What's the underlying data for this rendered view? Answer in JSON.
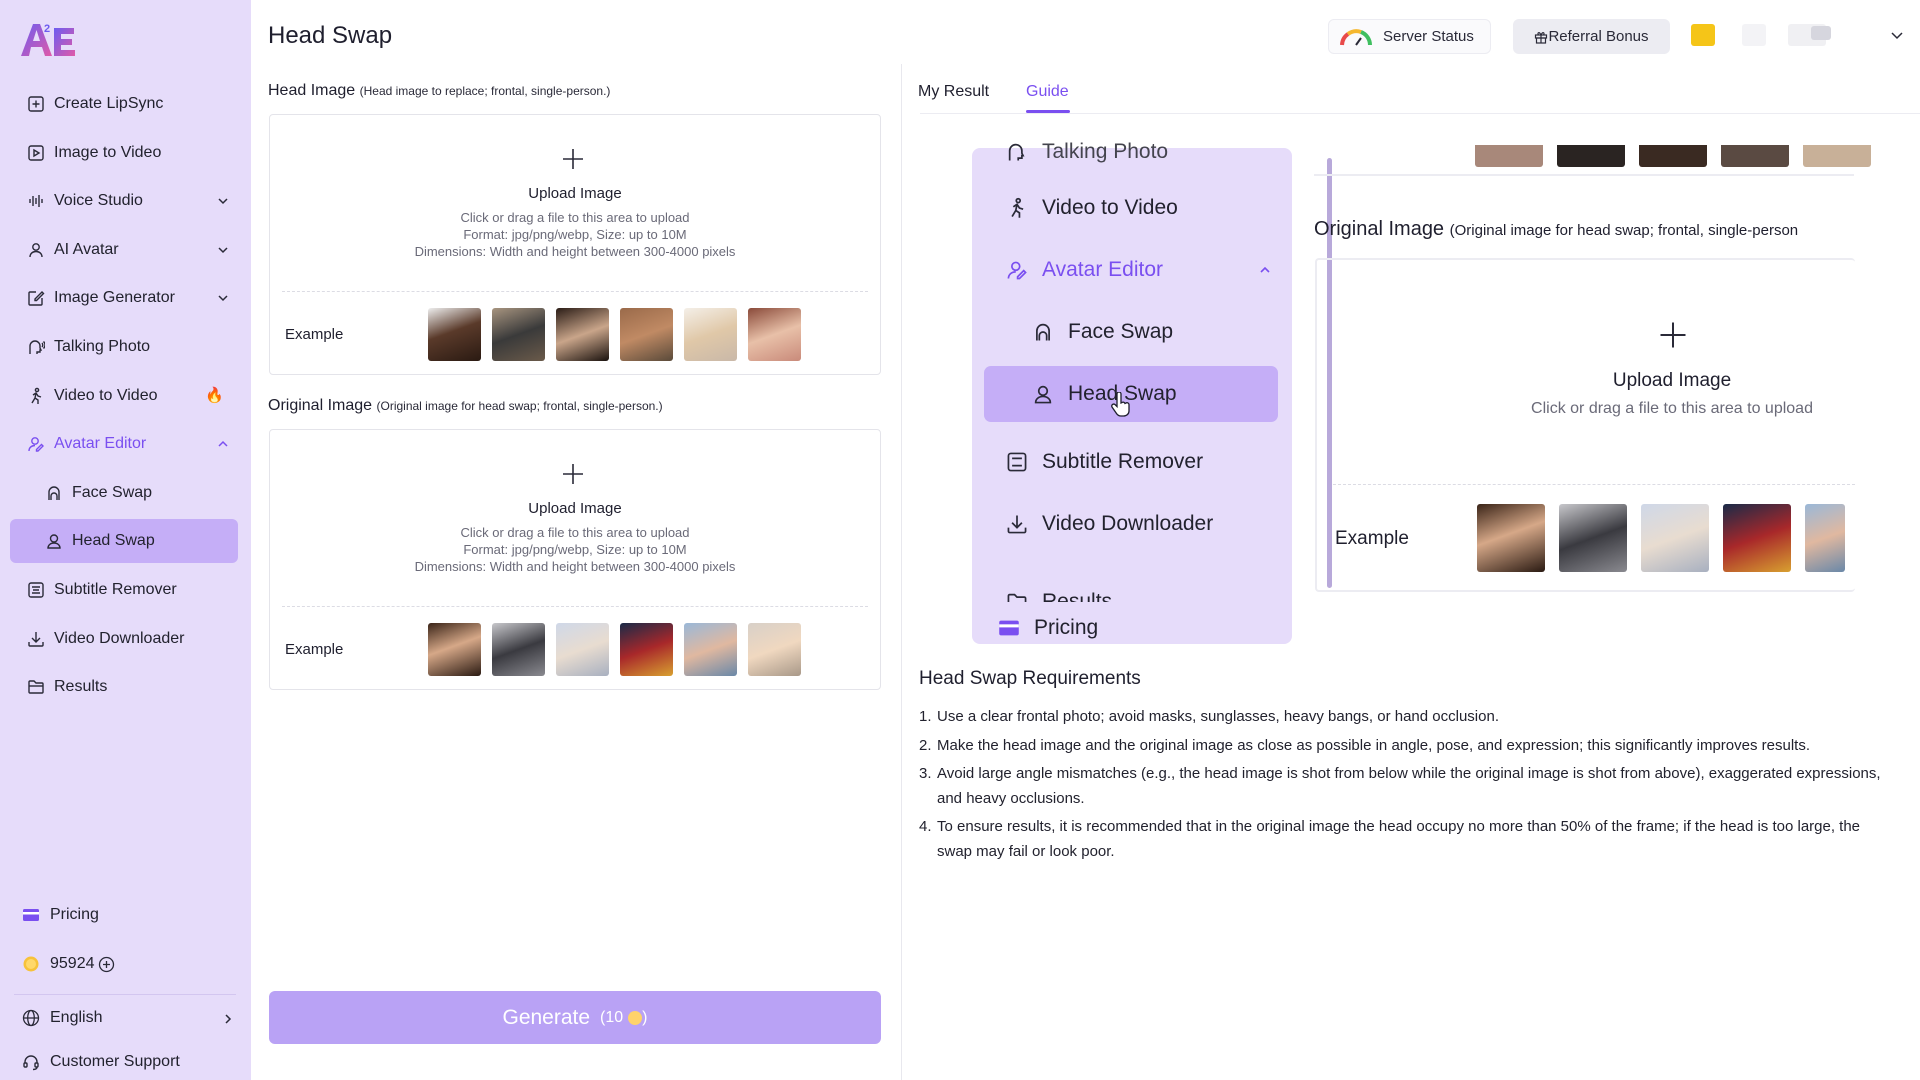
{
  "app": {
    "logo_text": "A²E",
    "page_title": "Head Swap"
  },
  "colors": {
    "accent": "#7a4ff0",
    "sidebar_bg": "#e6dcfa",
    "active_bg": "#c5aef7",
    "generate_bg": "#b9a2f5",
    "coin": "#ffd36a"
  },
  "sidebar": {
    "items": [
      {
        "label": "Create LipSync",
        "icon": "plus-square-icon"
      },
      {
        "label": "Image to Video",
        "icon": "image-play-icon"
      },
      {
        "label": "Voice Studio",
        "icon": "waveform-icon"
      },
      {
        "label": "AI Avatar",
        "icon": "user-icon"
      },
      {
        "label": "Image Generator",
        "icon": "edit-image-icon"
      },
      {
        "label": "Talking Photo",
        "icon": "speaking-head-icon"
      },
      {
        "label": "Video to Video",
        "icon": "running-person-icon"
      },
      {
        "label": "Avatar Editor",
        "icon": "user-edit-icon"
      },
      {
        "label": "Face Swap",
        "icon": "face-icon"
      },
      {
        "label": "Head Swap",
        "icon": "head-icon"
      },
      {
        "label": "Subtitle Remover",
        "icon": "subtitle-icon"
      },
      {
        "label": "Video Downloader",
        "icon": "download-icon"
      },
      {
        "label": "Results",
        "icon": "folder-icon"
      }
    ],
    "pricing": "Pricing",
    "credits": "95924",
    "language": "English",
    "support": "Customer Support"
  },
  "header": {
    "server_status": "Server Status",
    "referral": "Referral Bonus"
  },
  "head_image": {
    "label": "Head Image",
    "note": "(Head image to replace; frontal, single-person.)",
    "upload_title": "Upload Image",
    "hint1": "Click or drag a file to this area to upload",
    "hint2": "Format: jpg/png/webp, Size: up to 10M",
    "hint3": "Dimensions: Width and height between 300-4000 pixels",
    "example_label": "Example"
  },
  "original_image": {
    "label": "Original Image",
    "note": "(Original image for head swap; frontal, single-person.)",
    "upload_title": "Upload Image",
    "hint1": "Click or drag a file to this area to upload",
    "hint2": "Format: jpg/png/webp, Size: up to 10M",
    "hint3": "Dimensions: Width and height between 300-4000 pixels",
    "example_label": "Example"
  },
  "generate": {
    "label": "Generate",
    "cost": "(10",
    "cost_close": ")"
  },
  "tabs": {
    "my_result": "My Result",
    "guide": "Guide"
  },
  "guide": {
    "menu": {
      "talking_photo": "Talking Photo",
      "video_to_video": "Video to Video",
      "avatar_editor": "Avatar Editor",
      "face_swap": "Face Swap",
      "head_swap": "Head Swap",
      "subtitle_remover": "Subtitle Remover",
      "video_downloader": "Video Downloader",
      "results": "Results",
      "pricing": "Pricing"
    },
    "label": "Original Image",
    "note": "(Original image for head swap; frontal, single-person",
    "upload_title": "Upload Image",
    "hint1": "Click or drag a file to this area to upload",
    "example_label": "Example"
  },
  "requirements": {
    "title": "Head Swap Requirements",
    "items": [
      {
        "num": "1.",
        "text": "Use a clear frontal photo; avoid masks, sunglasses, heavy bangs, or hand occlusion."
      },
      {
        "num": "2.",
        "text": "Make the head image and the original image as close as possible in angle, pose, and expression; this significantly improves results."
      },
      {
        "num": "3.",
        "text": "Avoid large angle mismatches (e.g., the head image is shot from below while the original image is shot from above), exaggerated expressions, and heavy occlusions."
      },
      {
        "num": "4.",
        "text": "To ensure results, it is recommended that in the original image the head occupy no more than 50% of the frame; if the head is too large, the swap may fail or look poor."
      }
    ]
  }
}
